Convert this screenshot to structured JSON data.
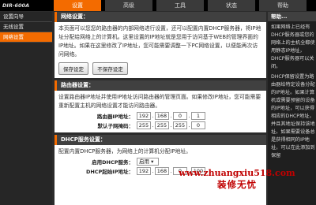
{
  "header": {
    "model": "DIR-600A",
    "tabs": [
      {
        "label": "设置"
      },
      {
        "label": "高级"
      },
      {
        "label": "工具"
      },
      {
        "label": "状态"
      },
      {
        "label": "帮助"
      }
    ]
  },
  "sidebar": {
    "items": [
      {
        "label": "设置向导"
      },
      {
        "label": "无线设置"
      },
      {
        "label": "网络设置"
      }
    ]
  },
  "network": {
    "title": "网络设置：",
    "desc": "本页面可以您您的路由器的内部网络进行设置，还可以配置内置DHCP服务器，将IP地址分配给网络上的计算机。这里设置的IP地址就是您用于访问基于WEB的管理界面的IP地址。如果在这里修改了IP地址，您可能需要调整一下PC网络设置，以便能再次访问网络。",
    "save_label": "保存设定",
    "nosave_label": "不保存设定"
  },
  "router": {
    "title": "路由器设置：",
    "desc": "设置路由器IP地址并使用IP地址访问路由器的管理页面。如果修改IP地址，您可能需要重新配置主机的网络设置才能访问路由器。",
    "ip_label": "路由器IP地址：",
    "ip": [
      "192",
      "168",
      "0",
      "1"
    ],
    "mask_label": "默认子网掩码：",
    "mask": [
      "255",
      "255",
      "255",
      "0"
    ]
  },
  "dhcp": {
    "title": "DHCP服务设置：",
    "desc": "配置内置DHCP服务器，为网络上的计算机分配IP地址。",
    "enable_label": "启用DHCP服务：",
    "enable_value": "启用",
    "start_label": "DHCP起始IP地址：",
    "start_ip": [
      "192",
      "168",
      "0",
      "100"
    ]
  },
  "help": {
    "title": "帮助...",
    "p1": "如果网络上已经有DHCP服务器或您的网络上的主机全都使用静态IP地址，DHCP服务器可以关闭。",
    "p2": "DHCP保留设置为路由器给特定设备分配的IP地址。如果计算机或需要预留的设备的IP地址，可以获得相应的DHCP地址，并且其地址保持该地址。如果需要设备总是获得相同的IP地址，可以在此添加到保留"
  },
  "watermark": {
    "url": "www.zhuangxiu518.com",
    "text": "装修无忧"
  },
  "colors": {
    "accent": "#f36b00",
    "watermark": "#c00000"
  }
}
